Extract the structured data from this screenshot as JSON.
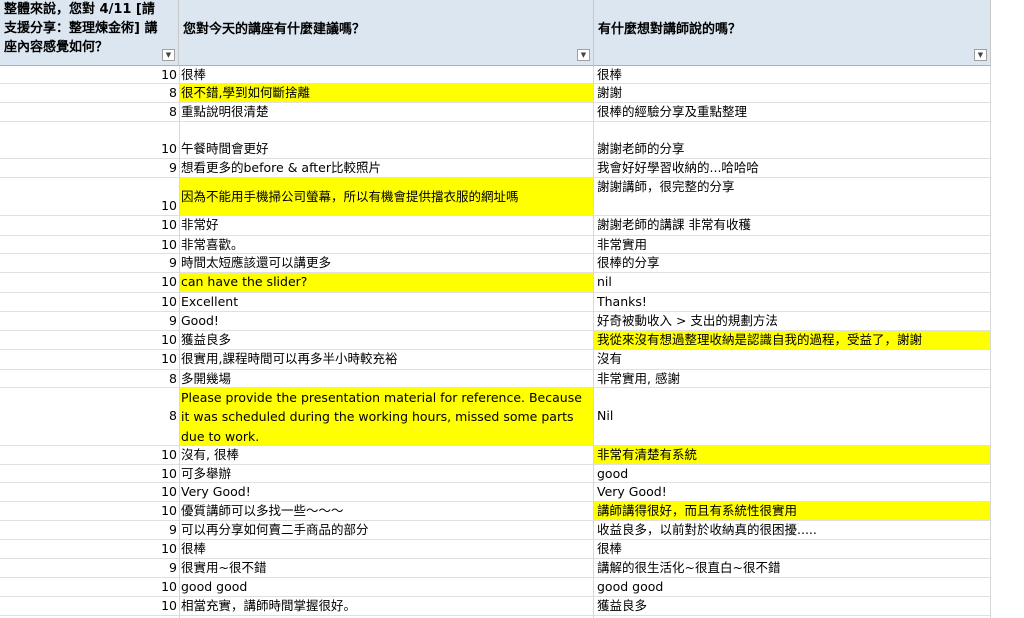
{
  "headers": {
    "score": "整體來說，您對 4/11 [請支援分享：整理煉金術] 講座內容感覺如何？",
    "suggestion": "您對今天的講座有什麼建議嗎？",
    "message": "有什麼想對講師說的嗎？",
    "filter_icon": "▼"
  },
  "colors": {
    "header_bg": "#dce6f1",
    "highlight": "#ffff00",
    "grid": "#d8d8d8"
  },
  "rows": [
    {
      "score": "10",
      "suggestion": "很棒",
      "message": "很棒"
    },
    {
      "score": "8",
      "suggestion": "很不錯,學到如何斷捨離",
      "message": "謝謝"
    },
    {
      "score": "8",
      "suggestion": "重點說明很清楚",
      "message": "很棒的經驗分享及重點整理"
    },
    {
      "score": "10",
      "suggestion": "午餐時間會更好",
      "message": "謝謝老師的分享"
    },
    {
      "score": "9",
      "suggestion": "想看更多的before & after比較照片",
      "message": "我會好好學習收納的...哈哈哈"
    },
    {
      "score": "10",
      "suggestion": "因為不能用手機掃公司螢幕，所以有機會提供擋衣服的網址嗎",
      "message": "謝謝講師，很完整的分享"
    },
    {
      "score": "10",
      "suggestion": "非常好",
      "message": "謝謝老師的講課 非常有收穫"
    },
    {
      "score": "10",
      "suggestion": "非常喜歡。",
      "message": "非常實用"
    },
    {
      "score": "9",
      "suggestion": "時間太短應該還可以講更多",
      "message": "很棒的分享"
    },
    {
      "score": "10",
      "suggestion": "can have the slider?",
      "message": "nil"
    },
    {
      "score": "10",
      "suggestion": "Excellent",
      "message": "Thanks!"
    },
    {
      "score": "9",
      "suggestion": "Good!",
      "message": "好奇被動收入 > 支出的規劃方法"
    },
    {
      "score": "10",
      "suggestion": "獲益良多",
      "message": "我從來沒有想過整理收納是認識自我的過程，受益了，謝謝"
    },
    {
      "score": "10",
      "suggestion": "很實用,課程時間可以再多半小時較充裕",
      "message": "沒有"
    },
    {
      "score": "8",
      "suggestion": "多開幾場",
      "message": "非常實用, 感謝"
    },
    {
      "score": "8",
      "suggestion": "Please provide the presentation material for reference.  Because it was scheduled during the working hours, missed some parts due to work.",
      "message": "Nil"
    },
    {
      "score": "10",
      "suggestion": "沒有, 很棒",
      "message": "非常有清楚有系統"
    },
    {
      "score": "10",
      "suggestion": "可多舉辦",
      "message": "good"
    },
    {
      "score": "10",
      "suggestion": "Very Good!",
      "message": "Very Good!"
    },
    {
      "score": "10",
      "suggestion": "優質講師可以多找一些～～～",
      "message": "講師講得很好，而且有系統性很實用"
    },
    {
      "score": "9",
      "suggestion": "可以再分享如何賣二手商品的部分",
      "message": "收益良多，以前對於收納真的很困擾....."
    },
    {
      "score": "10",
      "suggestion": "很棒",
      "message": "很棒"
    },
    {
      "score": "9",
      "suggestion": "很實用~很不錯",
      "message": "講解的很生活化~很直白~很不錯"
    },
    {
      "score": "10",
      "suggestion": "good good",
      "message": "good good"
    },
    {
      "score": "10",
      "suggestion": "相當充實，講師時間掌握很好。",
      "message": "獲益良多"
    }
  ]
}
